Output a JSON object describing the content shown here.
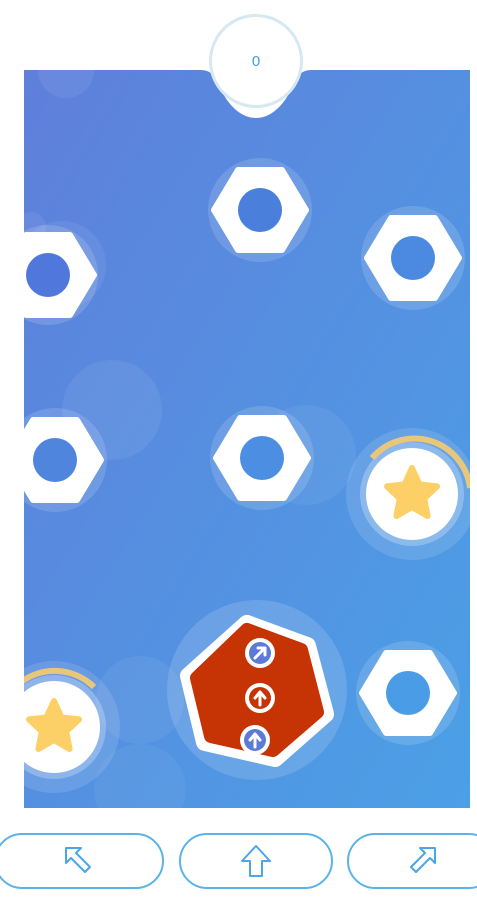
{
  "score": {
    "value": "0"
  },
  "board": {
    "colors": {
      "gradient_start": "#5f7fdb",
      "gradient_end": "#4ba0e6",
      "nut_fill": "#ffffff",
      "nut_hole": "#4a80de",
      "halo": "#ffffff",
      "star": "#fcd067",
      "star_ring": "#e9c77a",
      "player_fill": "#c63405",
      "player_arrow": "#5d7ad9"
    },
    "nuts": [
      {
        "name": "nut-top-center"
      },
      {
        "name": "nut-top-left"
      },
      {
        "name": "nut-top-right"
      },
      {
        "name": "nut-mid-left"
      },
      {
        "name": "nut-mid-center"
      },
      {
        "name": "nut-bottom-right"
      }
    ],
    "stars": [
      {
        "name": "star-bonus-right",
        "ring_progress": 0.3
      },
      {
        "name": "star-bonus-bottom-left",
        "ring_progress": 0.25
      }
    ],
    "player": {
      "name": "player-hexagon",
      "moves": [
        "arrow-up-right-icon",
        "arrow-up-icon",
        "arrow-up-icon"
      ]
    }
  },
  "controls": [
    {
      "name": "move-up-left-button",
      "icon": "arrow-up-left-icon"
    },
    {
      "name": "move-up-button",
      "icon": "arrow-up-icon"
    },
    {
      "name": "move-up-right-button",
      "icon": "arrow-up-right-icon"
    }
  ]
}
